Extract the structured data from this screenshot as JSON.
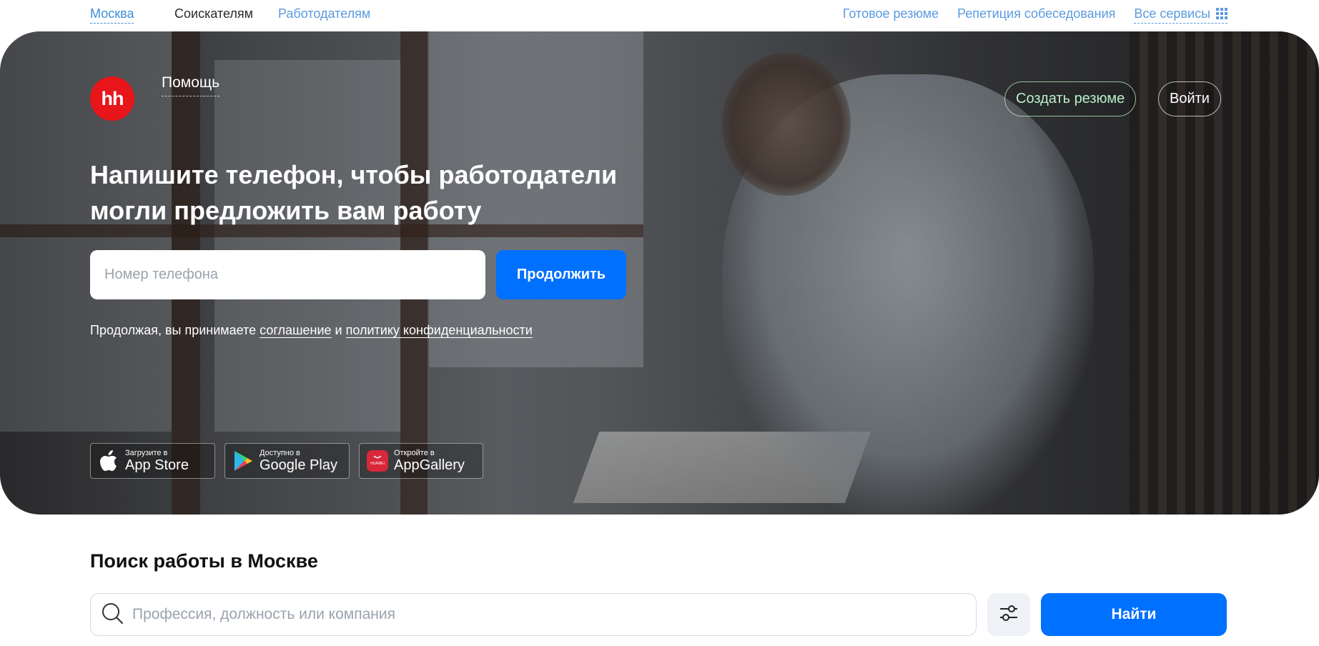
{
  "topbar": {
    "city": "Москва",
    "seekers": "Соискателям",
    "employers": "Работодателям",
    "ready_resume": "Готовое резюме",
    "interview_rehearsal": "Репетиция собеседования",
    "all_services": "Все сервисы"
  },
  "hero": {
    "logo_text": "hh",
    "help": "Помощь",
    "create_resume": "Создать резюме",
    "login": "Войти",
    "headline_line1": "Напишите телефон, чтобы работодатели",
    "headline_line2": "могли предложить вам работу",
    "phone_placeholder": "Номер телефона",
    "continue": "Продолжить",
    "consent_prefix": "Продолжая, вы принимаете",
    "consent_agreement": "соглашение",
    "consent_and": "и",
    "consent_policy": "политику конфиденциальности",
    "stores": [
      {
        "small": "Загрузите в",
        "big": "App Store"
      },
      {
        "small": "Доступно в",
        "big": "Google Play"
      },
      {
        "small": "Откройте в",
        "big": "AppGallery",
        "badge": "HUAWEI"
      }
    ]
  },
  "search": {
    "title": "Поиск работы в Москве",
    "placeholder": "Профессия, должность или компания",
    "find": "Найти"
  },
  "colors": {
    "accent": "#0070ff",
    "logo_red": "#e8151a",
    "link_blue": "#5a9be0"
  }
}
